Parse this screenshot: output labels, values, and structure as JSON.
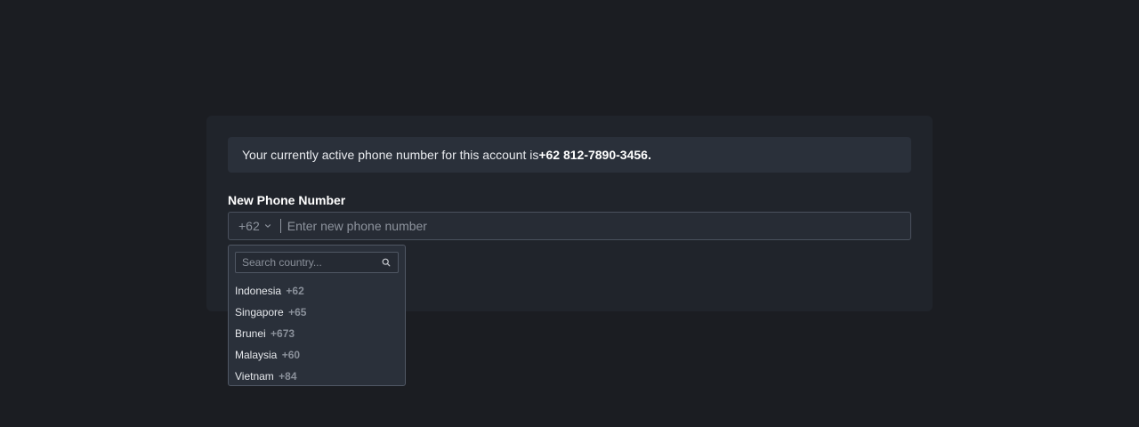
{
  "notice": {
    "text": "Your currently active phone number for this account is ",
    "phone": "+62 812-7890-3456."
  },
  "form": {
    "label": "New Phone Number",
    "selected_code": "+62",
    "number_placeholder": "Enter new phone number",
    "number_value": ""
  },
  "dropdown": {
    "search_placeholder": "Search country...",
    "countries": [
      {
        "name": "Indonesia",
        "code": "+62"
      },
      {
        "name": "Singapore",
        "code": "+65"
      },
      {
        "name": "Brunei",
        "code": "+673"
      },
      {
        "name": "Malaysia",
        "code": "+60"
      },
      {
        "name": "Vietnam",
        "code": "+84"
      }
    ]
  },
  "icons": {
    "chevron": "chevron-down-icon",
    "search": "search-icon"
  }
}
